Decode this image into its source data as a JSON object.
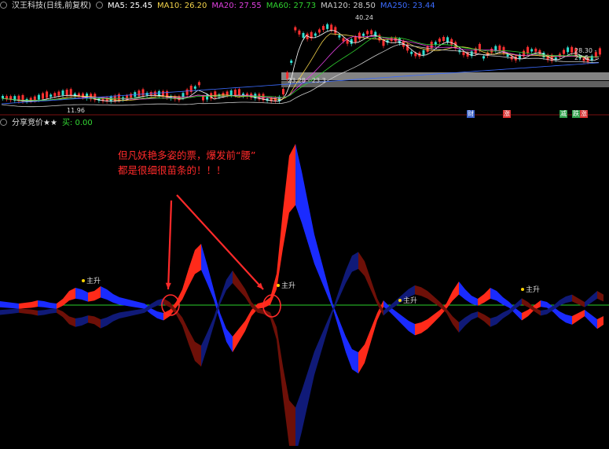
{
  "header": {
    "stock": "汉王科技(日线,前复权)",
    "ma": [
      {
        "label": "MA5: 25.45",
        "color": "#ffffff"
      },
      {
        "label": "MA10: 26.20",
        "color": "#f3d34a"
      },
      {
        "label": "MA20: 27.55",
        "color": "#e040e0"
      },
      {
        "label": "MA60: 27.73",
        "color": "#2fd12f"
      },
      {
        "label": "MA120: 28.50",
        "color": "#cccccc"
      },
      {
        "label": "MA250: 23.44",
        "color": "#3b6bff"
      }
    ]
  },
  "price_panel": {
    "price_labels": [
      "40.24",
      "11.96",
      "28.30 - 27.6",
      "23.28 - 23.3"
    ],
    "tags": [
      {
        "text": "财",
        "color": "#3a5fc8"
      },
      {
        "text": "涨",
        "color": "#d83030"
      },
      {
        "text": "减",
        "color": "#2e9e4a"
      },
      {
        "text": "跌",
        "color": "#2e9e4a"
      },
      {
        "text": "涨",
        "color": "#d83030"
      }
    ]
  },
  "indicator_header": {
    "name": "分享竞价★★",
    "value": "买: 0.00",
    "value_color": "#33d633"
  },
  "annotation": {
    "line1": "但凡妖艳多姿的票，爆发前“腰”",
    "line2": "都是很细很苗条的！！！"
  },
  "signal_label": "主升",
  "chart_data": {
    "type": "area",
    "description_series": [
      {
        "name": "red",
        "color": "#ff2a1a"
      },
      {
        "name": "blue",
        "color": "#1a2bff"
      }
    ],
    "x": [
      0,
      8,
      16,
      24,
      32,
      40,
      48,
      56,
      64,
      72,
      80,
      88,
      96,
      104,
      112,
      120,
      128,
      136,
      144,
      152,
      160,
      168,
      176,
      184,
      192,
      200,
      208,
      216,
      224,
      232,
      240,
      248,
      256,
      264,
      272,
      280,
      288,
      296,
      304,
      312,
      320,
      328,
      336,
      344,
      352,
      360,
      368,
      376,
      384,
      392,
      400,
      408,
      416,
      424,
      432,
      440,
      448,
      456,
      464,
      472,
      480,
      488,
      496,
      504,
      512,
      520,
      528,
      536,
      544,
      552,
      560,
      568,
      576,
      584,
      592,
      600,
      608,
      616,
      624,
      632,
      640,
      648,
      656,
      664,
      672,
      680,
      688,
      696,
      704,
      712,
      720,
      728,
      736,
      744,
      752,
      760,
      768
    ],
    "values": [
      5,
      4,
      3,
      2,
      3,
      4,
      6,
      5,
      3,
      2,
      8,
      18,
      22,
      20,
      16,
      18,
      24,
      20,
      14,
      10,
      8,
      6,
      4,
      2,
      -4,
      -8,
      -10,
      -6,
      4,
      20,
      46,
      70,
      78,
      50,
      20,
      -10,
      -30,
      -40,
      -30,
      -20,
      -6,
      2,
      4,
      10,
      40,
      120,
      190,
      205,
      170,
      130,
      90,
      60,
      30,
      0,
      -20,
      -40,
      -56,
      -60,
      -50,
      -30,
      -10,
      6,
      -2,
      -8,
      -14,
      -20,
      -24,
      -22,
      -18,
      -12,
      -6,
      2,
      18,
      30,
      20,
      12,
      8,
      14,
      22,
      18,
      10,
      4,
      -4,
      -10,
      -6,
      0,
      6,
      4,
      -2,
      -8,
      -12,
      -14,
      -10,
      -6,
      -12,
      -18,
      -14
    ]
  }
}
